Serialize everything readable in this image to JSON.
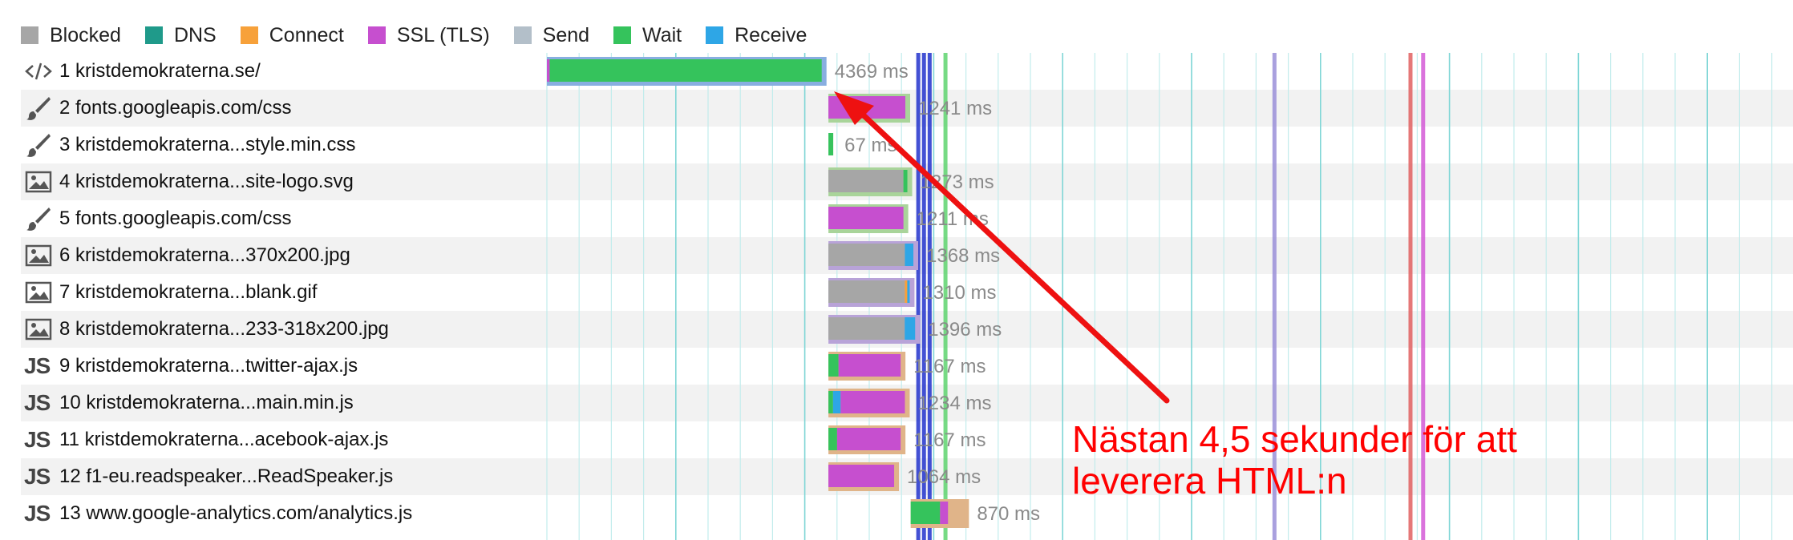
{
  "legend": [
    {
      "label": "Blocked",
      "color": "#a6a6a6"
    },
    {
      "label": "DNS",
      "color": "#1f9a8a"
    },
    {
      "label": "Connect",
      "color": "#f7a13a"
    },
    {
      "label": "SSL (TLS)",
      "color": "#c64fcf"
    },
    {
      "label": "Send",
      "color": "#b3bfc9"
    },
    {
      "label": "Wait",
      "color": "#35c35c"
    },
    {
      "label": "Receive",
      "color": "#2ea6e6"
    }
  ],
  "requests": [
    {
      "label": "1 kristdemokraterna.se/",
      "icon": "html-icon",
      "time": "4369 ms",
      "start": 0,
      "ms": 4369,
      "bar": [
        [
          "#c64fcf",
          0.01
        ],
        [
          "#35c35c",
          0.99
        ]
      ],
      "under": "#88aee0"
    },
    {
      "label": "2 fonts.googleapis.com/css",
      "icon": "css-icon",
      "time": "1241 ms",
      "start": 4450,
      "ms": 1241,
      "bar": [
        [
          "#c64fcf",
          1.0
        ]
      ],
      "under": "#a9d49a"
    },
    {
      "label": "3 kristdemokraterna...style.min.css",
      "icon": "css-icon",
      "time": "67 ms",
      "start": 4450,
      "ms": 67,
      "bar": [
        [
          "#35c35c",
          1.0
        ]
      ],
      "under": ""
    },
    {
      "label": "4 kristdemokraterna...site-logo.svg",
      "icon": "image-icon",
      "time": "1273 ms",
      "start": 4450,
      "ms": 1273,
      "bar": [
        [
          "#a6a6a6",
          0.95
        ],
        [
          "#35c35c",
          0.05
        ]
      ],
      "under": "#a9d49a"
    },
    {
      "label": "5 fonts.googleapis.com/css",
      "icon": "css-icon",
      "time": "1211 ms",
      "start": 4450,
      "ms": 1211,
      "bar": [
        [
          "#c64fcf",
          1.0
        ]
      ],
      "under": "#a9d49a"
    },
    {
      "label": "6 kristdemokraterna...370x200.jpg",
      "icon": "image-icon",
      "time": "1368 ms",
      "start": 4450,
      "ms": 1368,
      "bar": [
        [
          "#a6a6a6",
          0.9
        ],
        [
          "#2ea6e6",
          0.1
        ]
      ],
      "under": "#b8a3d8"
    },
    {
      "label": "7 kristdemokraterna...blank.gif",
      "icon": "image-icon",
      "time": "1310 ms",
      "start": 4450,
      "ms": 1310,
      "bar": [
        [
          "#a6a6a6",
          0.94
        ],
        [
          "#f7a13a",
          0.03
        ],
        [
          "#2ea6e6",
          0.03
        ]
      ],
      "under": "#b8a3d8"
    },
    {
      "label": "8 kristdemokraterna...233-318x200.jpg",
      "icon": "image-icon",
      "time": "1396 ms",
      "start": 4450,
      "ms": 1396,
      "bar": [
        [
          "#a6a6a6",
          0.88
        ],
        [
          "#2ea6e6",
          0.12
        ]
      ],
      "under": "#b8a3d8"
    },
    {
      "label": "9 kristdemokraterna...twitter-ajax.js",
      "icon": "js-icon",
      "time": "1167 ms",
      "start": 4450,
      "ms": 1167,
      "bar": [
        [
          "#35c35c",
          0.14
        ],
        [
          "#c64fcf",
          0.86
        ]
      ],
      "under": "#e0b489"
    },
    {
      "label": "10 kristdemokraterna...main.min.js",
      "icon": "js-icon",
      "time": "1234 ms",
      "start": 4450,
      "ms": 1234,
      "bar": [
        [
          "#35c35c",
          0.06
        ],
        [
          "#2ea6e6",
          0.1
        ],
        [
          "#c64fcf",
          0.84
        ]
      ],
      "under": "#e0b489"
    },
    {
      "label": "11 kristdemokraterna...acebook-ajax.js",
      "icon": "js-icon",
      "time": "1167 ms",
      "start": 4450,
      "ms": 1167,
      "bar": [
        [
          "#35c35c",
          0.12
        ],
        [
          "#c64fcf",
          0.88
        ]
      ],
      "under": "#e0b489"
    },
    {
      "label": "12 f1-eu.readspeaker...ReadSpeaker.js",
      "icon": "js-icon",
      "time": "1064 ms",
      "start": 4450,
      "ms": 1064,
      "bar": [
        [
          "#c64fcf",
          1.0
        ]
      ],
      "under": "#e0b489"
    },
    {
      "label": "13 www.google-analytics.com/analytics.js",
      "icon": "js-icon",
      "time": "870 ms",
      "start": 5750,
      "ms": 870,
      "bar": [
        [
          "#35c35c",
          0.55
        ],
        [
          "#c64fcf",
          0.15
        ],
        [
          "#e0b489",
          0.3
        ]
      ],
      "under": "#e0b489"
    }
  ],
  "markers": [
    {
      "ms": 5870,
      "color": "#2233cc"
    },
    {
      "ms": 5960,
      "color": "#2233cc"
    },
    {
      "ms": 6050,
      "color": "#2233cc"
    },
    {
      "ms": 6300,
      "color": "#5ed46e"
    },
    {
      "ms": 11500,
      "color": "#9a8fd8"
    },
    {
      "ms": 13650,
      "color": "#e06060"
    },
    {
      "ms": 13850,
      "color": "#d35ad6"
    }
  ],
  "annotation": {
    "line1": "Nästan 4,5 sekunder för att",
    "line2": "leverera HTML:n"
  }
}
